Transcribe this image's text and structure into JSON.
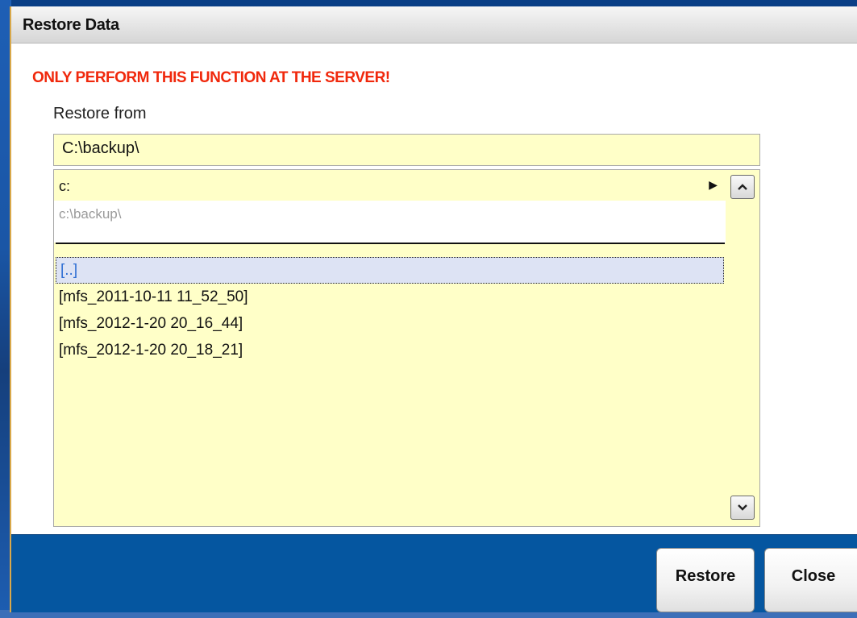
{
  "window": {
    "title": "Restore Data",
    "warning": "ONLY PERFORM THIS FUNCTION AT THE SERVER!",
    "restore_from_label": "Restore from",
    "path_value": "C:\\backup\\"
  },
  "drive": {
    "selected": "c:",
    "arrow_icon": "right-triangle-icon"
  },
  "current_path": "c:\\backup\\",
  "folders": [
    "[..]",
    "[mfs_2011-10-11 11_52_50]",
    "[mfs_2012-1-20 20_16_44]",
    "[mfs_2012-1-20 20_18_21]"
  ],
  "selected_folder_index": 0,
  "buttons": {
    "restore": "Restore",
    "close": "Close"
  },
  "colors": {
    "warning": "#f0280c",
    "list_background": "#ffffc8",
    "footer": "#0556a0",
    "selected_text": "#2f6fd3"
  }
}
